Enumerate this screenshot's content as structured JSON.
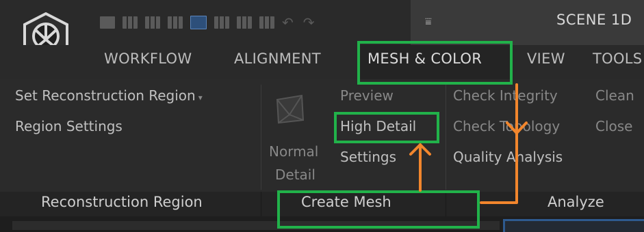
{
  "app": {
    "scene_title": "SCENE 1D",
    "quick_access": [
      "layout-1-icon",
      "layout-2-icon",
      "layout-3-icon",
      "layout-4-icon",
      "layout-5-icon",
      "layout-6-icon",
      "layout-7-icon",
      "layout-8-icon",
      "undo-icon",
      "redo-icon"
    ],
    "undo_glyph": "↶",
    "redo_glyph": "↷",
    "dropdown_glyph": "⩸"
  },
  "tabs": [
    "WORKFLOW",
    "ALIGNMENT",
    "MESH & COLOR",
    "VIEW",
    "TOOLS"
  ],
  "active_tab": "MESH & COLOR",
  "ribbon": {
    "reconstruction": {
      "set_region": "Set Reconstruction Region",
      "region_settings": "Region Settings",
      "caret": "▾"
    },
    "create_mesh": {
      "normal_line1": "Normal",
      "normal_line2": "Detail",
      "preview": "Preview",
      "high_detail": "High Detail",
      "settings": "Settings"
    },
    "analyze": {
      "check_integrity": "Check Integrity",
      "check_topology": "Check Topology",
      "quality_analysis": "Quality Analysis",
      "clean": "Clean",
      "close": "Close"
    }
  },
  "groups": [
    "Reconstruction Region",
    "Create Mesh",
    "Analyze"
  ],
  "annotation_colors": {
    "highlight": "#21b24a",
    "arrow": "#f2862d"
  }
}
